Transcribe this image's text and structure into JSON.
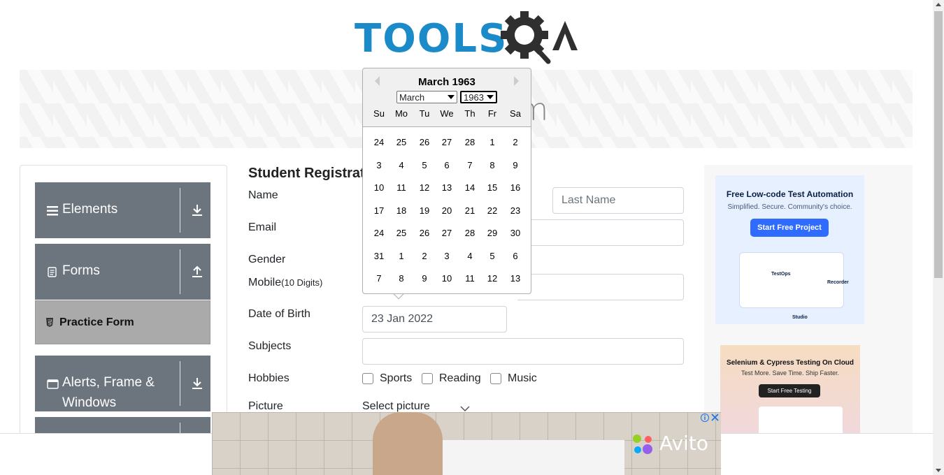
{
  "logo": {
    "text": "TOOLS",
    "suffix": "A"
  },
  "banner": {
    "title_visible": "rm"
  },
  "sidebar": {
    "groups": [
      {
        "label": "Elements",
        "icon": "list-icon",
        "arrow": "download-arrow-icon"
      },
      {
        "label": "Forms",
        "icon": "document-icon",
        "arrow": "upload-arrow-icon"
      },
      {
        "label": "Alerts, Frame &",
        "label2": "Windows",
        "icon": "window-icon",
        "arrow": "download-arrow-icon"
      }
    ],
    "active_item": {
      "label": "Practice Form",
      "icon": "html5-icon"
    }
  },
  "form": {
    "title": "Student Registrati",
    "labels": {
      "name": "Name",
      "email": "Email",
      "gender": "Gender",
      "mobile": "Mobile",
      "mobile_hint": "(10 Digits)",
      "dob": "Date of Birth",
      "subjects": "Subjects",
      "hobbies": "Hobbies",
      "picture": "Picture"
    },
    "last_name_placeholder": "Last Name",
    "dob_value": "23 Jan 2022",
    "hobbies": [
      "Sports",
      "Reading",
      "Music"
    ],
    "picture_select": "Select picture"
  },
  "datepicker": {
    "title": "March 1963",
    "month_select": "March",
    "year_select": "1963",
    "weekdays": [
      "Su",
      "Mo",
      "Tu",
      "We",
      "Th",
      "Fr",
      "Sa"
    ],
    "weeks": [
      [
        "24",
        "25",
        "26",
        "27",
        "28",
        "1",
        "2"
      ],
      [
        "3",
        "4",
        "5",
        "6",
        "7",
        "8",
        "9"
      ],
      [
        "10",
        "11",
        "12",
        "13",
        "14",
        "15",
        "16"
      ],
      [
        "17",
        "18",
        "19",
        "20",
        "21",
        "22",
        "23"
      ],
      [
        "24",
        "25",
        "26",
        "27",
        "28",
        "29",
        "30"
      ],
      [
        "31",
        "1",
        "2",
        "3",
        "4",
        "5",
        "6"
      ],
      [
        "7",
        "8",
        "9",
        "10",
        "11",
        "12",
        "13"
      ]
    ]
  },
  "ads": {
    "right1": {
      "title": "Free Low-code Test Automation",
      "subtitle": "Simplified. Secure. Community's choice.",
      "button": "Start Free Project",
      "labels": [
        "TestOps",
        "Recorder",
        "Studio"
      ]
    },
    "right2": {
      "title": "Selenium & Cypress Testing On Cloud",
      "subtitle": "Test More. Save Time. Ship Faster.",
      "button": "Start Free Testing"
    },
    "bottom": {
      "brand": "Avito"
    }
  },
  "colors": {
    "accent": "#1a8bc8",
    "sidebar": "#6c757d",
    "active": "#aaaaaa"
  }
}
